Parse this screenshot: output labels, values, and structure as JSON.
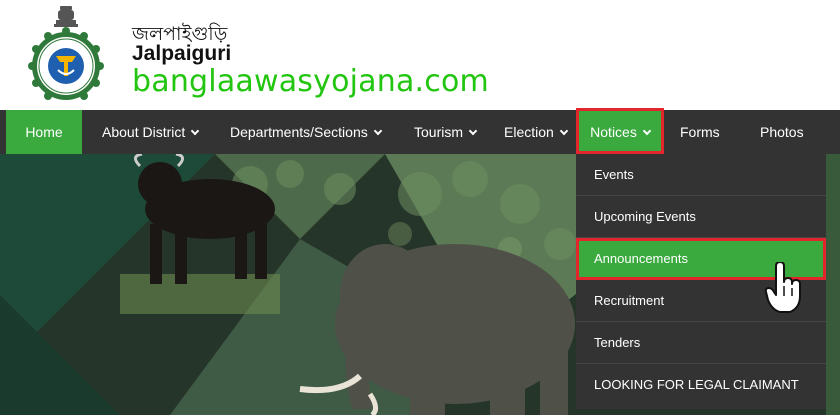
{
  "header": {
    "title_bn": "জলপাইগুড়ি",
    "title_en": "Jalpaiguri",
    "watermark": "banglaawasyojana.com"
  },
  "nav": {
    "items": [
      {
        "label": "Home"
      },
      {
        "label": "About District"
      },
      {
        "label": "Departments/Sections"
      },
      {
        "label": "Tourism"
      },
      {
        "label": "Election"
      },
      {
        "label": "Notices"
      },
      {
        "label": "Forms"
      },
      {
        "label": "Photos"
      }
    ]
  },
  "dropdown": {
    "items": [
      {
        "label": "Events"
      },
      {
        "label": "Upcoming Events"
      },
      {
        "label": "Announcements"
      },
      {
        "label": "Recruitment"
      },
      {
        "label": "Tenders"
      },
      {
        "label": "LOOKING FOR LEGAL CLAIMANT"
      }
    ]
  },
  "colors": {
    "nav_bg": "#333333",
    "accent_green": "#3aa93e",
    "highlight_red": "#e3262c",
    "watermark_green": "#22c50f"
  },
  "icons": {
    "emblem": "west-bengal-emblem",
    "cursor": "hand-pointer-icon"
  }
}
